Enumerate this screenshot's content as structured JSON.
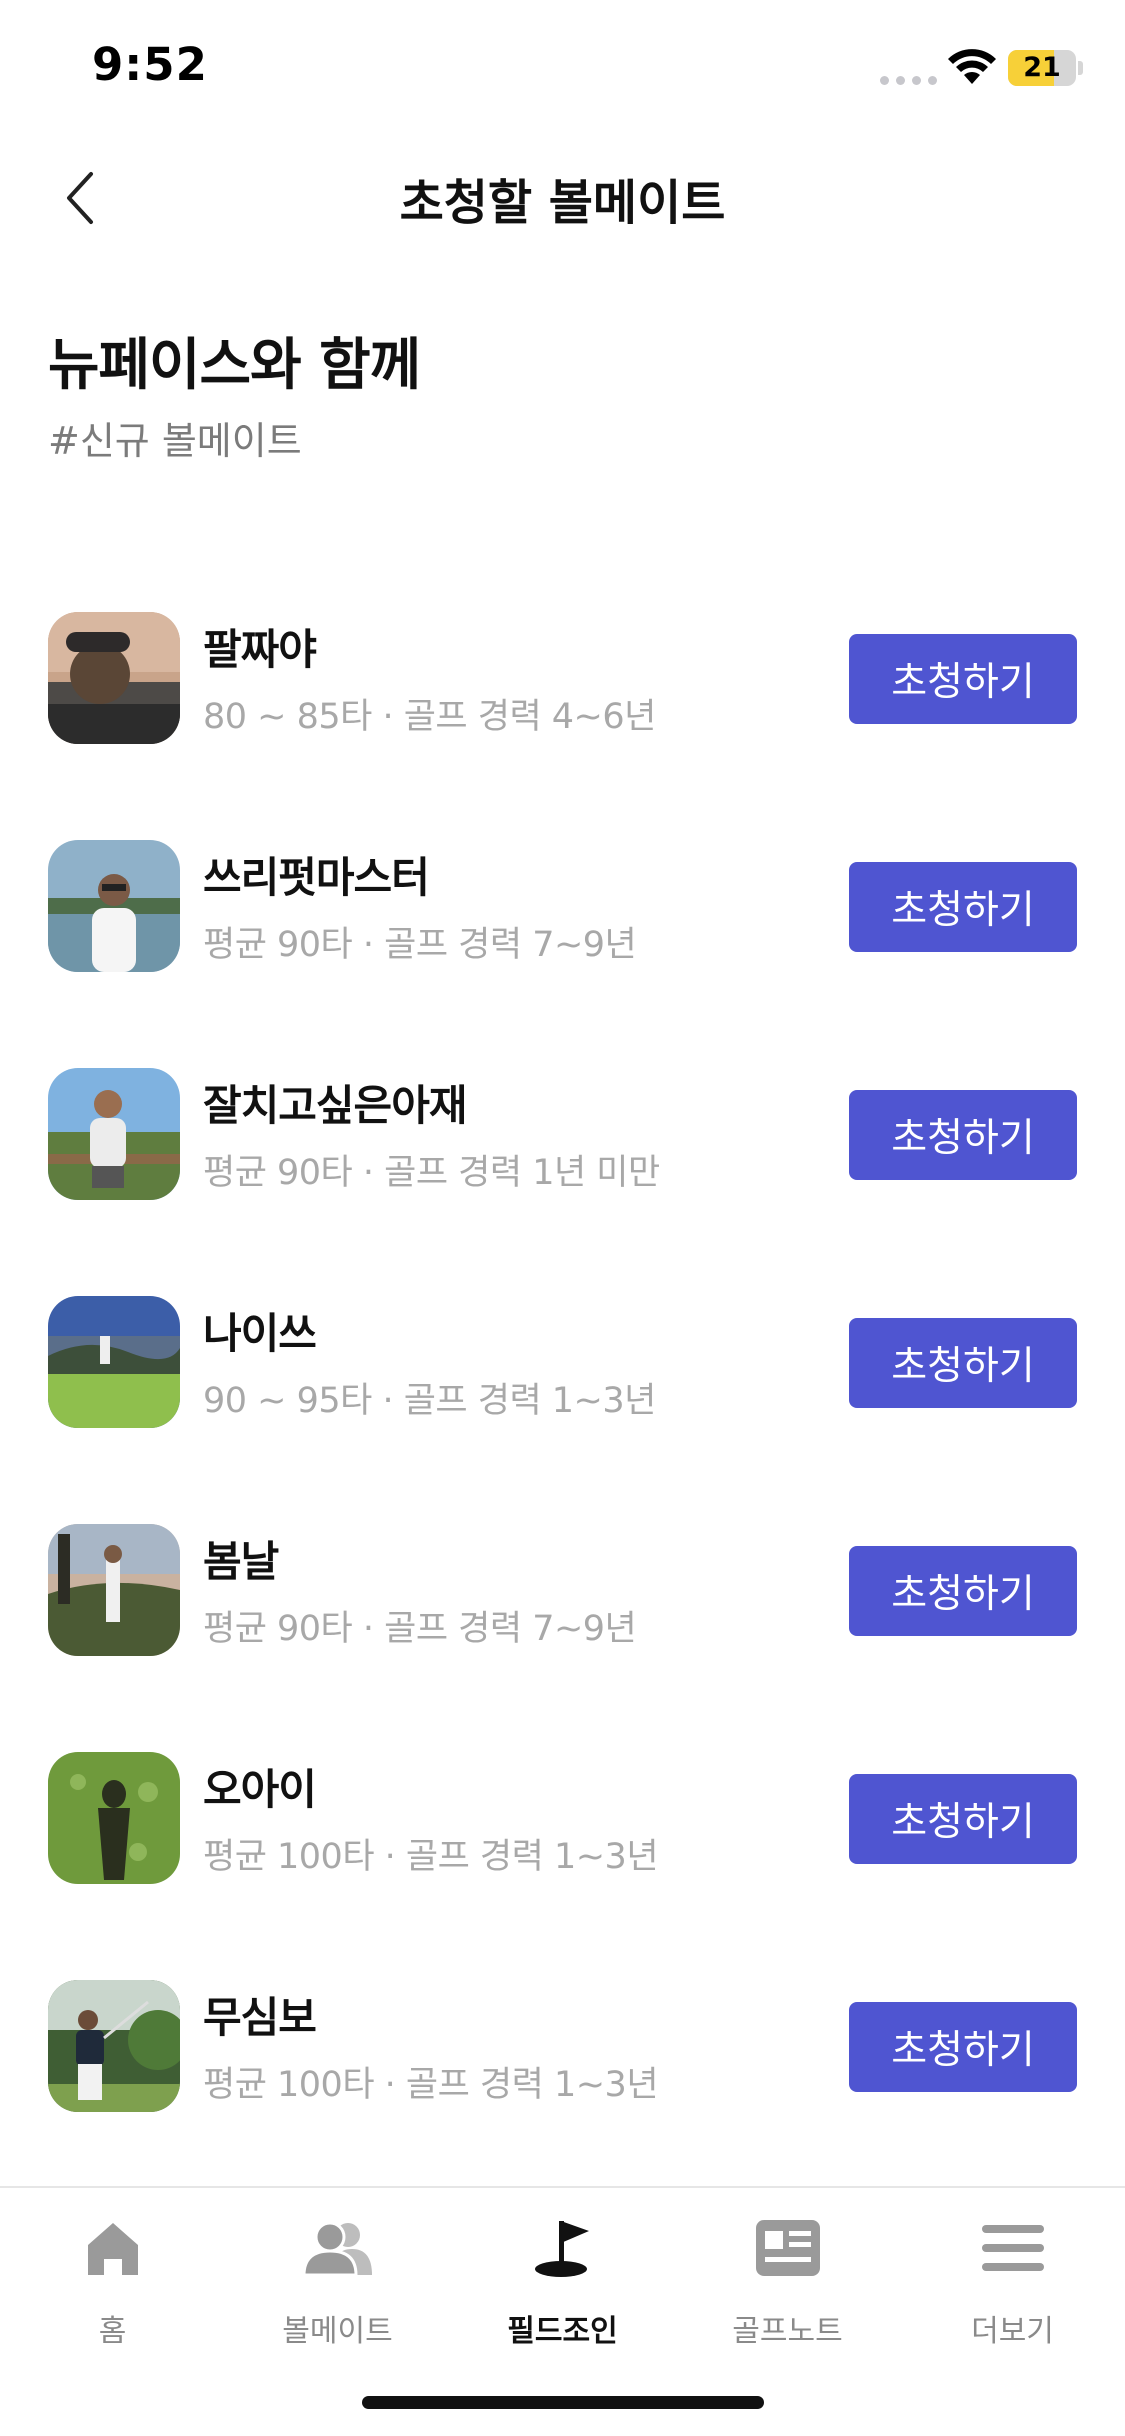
{
  "status_bar": {
    "time": "9:52",
    "battery_level": "21",
    "battery_fraction": 0.21,
    "icons": [
      "signal-icon",
      "wifi-icon",
      "battery-icon"
    ]
  },
  "header": {
    "title": "초청할 볼메이트",
    "back_icon": "chevron-left-icon"
  },
  "section": {
    "title": "뉴페이스와 함께",
    "tag": "#신규 볼메이트"
  },
  "colors": {
    "accent": "#4f55d1",
    "secondary_text": "#a8a8a8"
  },
  "users": [
    {
      "name": "팔짜야",
      "meta": "80 ~ 85타 · 골프 경력 4~6년",
      "button": "초청하기"
    },
    {
      "name": "쓰리펏마스터",
      "meta": "평균 90타 · 골프 경력 7~9년",
      "button": "초청하기"
    },
    {
      "name": "잘치고싶은아재",
      "meta": "평균 90타 · 골프 경력 1년 미만",
      "button": "초청하기"
    },
    {
      "name": "나이쓰",
      "meta": "90 ~ 95타 · 골프 경력 1~3년",
      "button": "초청하기"
    },
    {
      "name": "봄날",
      "meta": "평균 90타 · 골프 경력 7~9년",
      "button": "초청하기"
    },
    {
      "name": "오아이",
      "meta": "평균 100타 · 골프 경력 1~3년",
      "button": "초청하기"
    },
    {
      "name": "무심보",
      "meta": "평균 100타 · 골프 경력 1~3년",
      "button": "초청하기"
    }
  ],
  "tabs": [
    {
      "label": "홈",
      "icon": "home-icon",
      "active": false
    },
    {
      "label": "볼메이트",
      "icon": "people-icon",
      "active": false
    },
    {
      "label": "필드조인",
      "icon": "golf-flag-icon",
      "active": true
    },
    {
      "label": "골프노트",
      "icon": "note-icon",
      "active": false
    },
    {
      "label": "더보기",
      "icon": "menu-icon",
      "active": false
    }
  ]
}
